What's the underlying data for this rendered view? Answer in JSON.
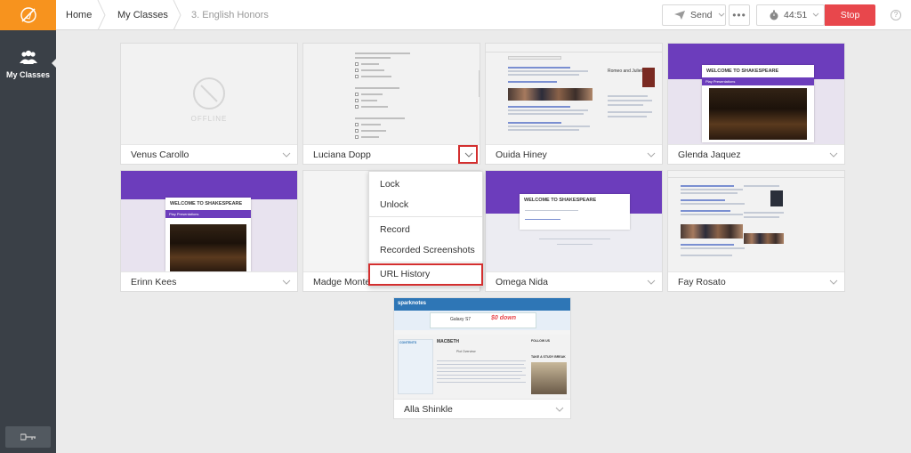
{
  "sidebar": {
    "nav_label": "My Classes"
  },
  "header": {
    "breadcrumbs": [
      "Home",
      "My Classes",
      "3. English Honors"
    ],
    "send_label": "Send",
    "more_label": "•••",
    "timer": "44:51",
    "stop_label": "Stop",
    "help_label": "?"
  },
  "students": [
    {
      "name": "Venus Carollo",
      "status": "OFFLINE"
    },
    {
      "name": "Luciana Dopp"
    },
    {
      "name": "Ouida Hiney"
    },
    {
      "name": "Glenda Jaquez"
    },
    {
      "name": "Erinn Kees"
    },
    {
      "name": "Madge Monte"
    },
    {
      "name": "Omega Nida"
    },
    {
      "name": "Fay Rosato"
    },
    {
      "name": "Alla Shinkle"
    }
  ],
  "screens": {
    "shakespeare_title": "WELCOME TO SHAKESPEARE",
    "shakespeare_sub": "Play Presentations",
    "google_result_title": "Romeo and Juliet",
    "sparknotes_logo": "sparknotes",
    "galaxy_ad": "Galaxy S7",
    "galaxy_ad_price": "$0 down",
    "spark_heading": "MACBETH",
    "spark_contents": "CONTENTS",
    "spark_follow": "FOLLOW US",
    "spark_study": "TAKE A STUDY BREAK",
    "spark_overview": "Plot Overview"
  },
  "menu": {
    "items": [
      "Lock",
      "Unlock",
      "Record",
      "Recorded Screenshots",
      "URL History"
    ]
  },
  "colors": {
    "accent_orange": "#f7931e",
    "stop_red": "#e8474c",
    "sidebar": "#3a4047",
    "highlight_red": "#d32f2f",
    "shakespeare_purple": "#6c3dbc"
  }
}
